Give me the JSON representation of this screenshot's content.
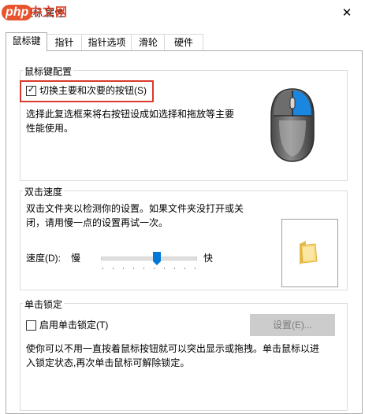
{
  "window": {
    "title": "鼠标 属性",
    "close_glyph": "✕"
  },
  "watermark": {
    "logo_php": "php",
    "logo_cn": "中文网"
  },
  "tabs": [
    {
      "label": "鼠标键",
      "active": true
    },
    {
      "label": "指针",
      "active": false
    },
    {
      "label": "指针选项",
      "active": false
    },
    {
      "label": "滑轮",
      "active": false
    },
    {
      "label": "硬件",
      "active": false
    }
  ],
  "button_config": {
    "group_label": "鼠标键配置",
    "switch_label": "切换主要和次要的按钮(S)",
    "switch_checked": true,
    "check_glyph": "✓",
    "description_line1": "选择此复选框来将右按钮设成如选择和拖放等主要",
    "description_line2": "性能使用。",
    "mouse_icon": "mouse-icon",
    "highlight_color": "#d93a2b"
  },
  "double_click": {
    "group_label": "双击速度",
    "description_line1": "双击文件夹以检测你的设置。如果文件夹没打开或关",
    "description_line2": "闭，请用慢一点的设置再试一次。",
    "speed_label": "速度(D):",
    "slow_label": "慢",
    "fast_label": "快",
    "speed_level_fraction": 0.6,
    "folder_icon": "folder-icon"
  },
  "click_lock": {
    "group_label": "单击锁定",
    "enable_label": "启用单击锁定(T)",
    "enable_checked": false,
    "settings_button": "设置(E)...",
    "description_line1": "使你可以不用一直按着鼠标按钮就可以突出显示或拖拽。单击鼠标以进",
    "description_line2": "入锁定状态,再次单击鼠标可解除锁定。"
  },
  "colors": {
    "accent": "#0078d7",
    "button_disabled_bg": "#cccccc"
  }
}
